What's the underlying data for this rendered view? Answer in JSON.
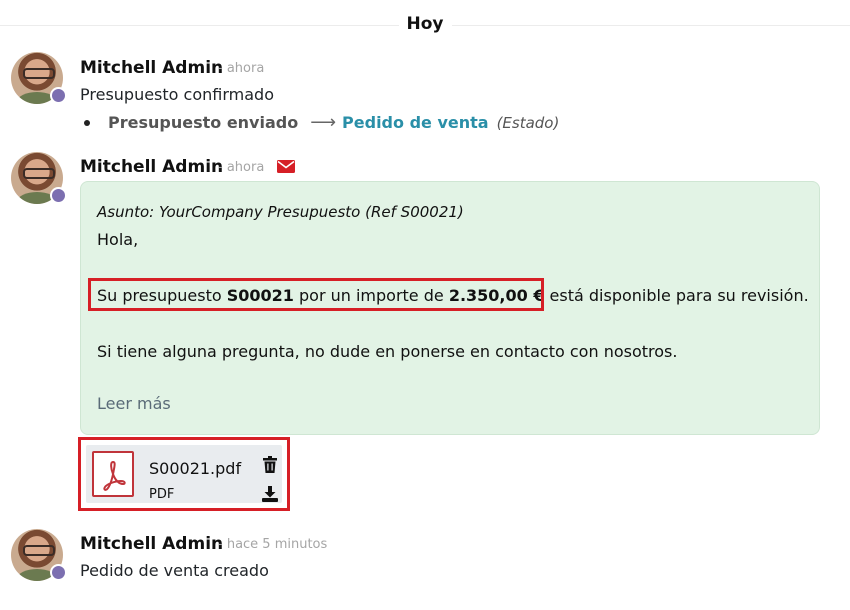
{
  "day_separator": "Hoy",
  "messages": [
    {
      "author": "Mitchell Admin",
      "time": "- ahora",
      "body": "Presupuesto confirmado",
      "tracking": {
        "old_value": "Presupuesto enviado",
        "new_value": "Pedido de venta",
        "field": "(Estado)"
      }
    },
    {
      "author": "Mitchell Admin",
      "time": "- ahora",
      "icon": "envelope-icon",
      "email": {
        "subject": "Asunto: YourCompany Presupuesto (Ref S00021)",
        "greeting": "Hola,",
        "sentence_prefix": "Su presupuesto ",
        "reference": "S00021",
        "sentence_middle": " por un importe de ",
        "amount": "2.350,00 €",
        "sentence_suffix": " está disponible para su revisión.",
        "question": "Si tiene alguna pregunta, no dude en ponerse en contacto con nosotros.",
        "read_more": "Leer más"
      },
      "attachment": {
        "name": "S00021.pdf",
        "type": "PDF"
      }
    },
    {
      "author": "Mitchell Admin",
      "time": "- hace 5 minutos",
      "body": "Pedido de venta creado"
    }
  ],
  "colors": {
    "highlight": "#d61f26",
    "email_bg": "#e2f3e5",
    "link": "#2a8fa8",
    "presence": "#7c6fb0",
    "pdf_red": "#c0343a"
  }
}
